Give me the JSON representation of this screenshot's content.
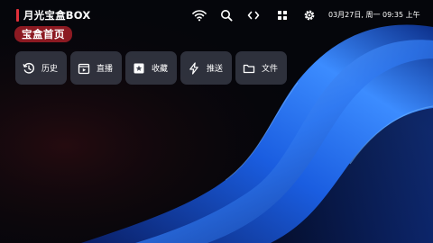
{
  "app": {
    "title": "月光宝盒BOX",
    "accent_color": "#e0303a"
  },
  "status_bar": {
    "icons": [
      "wifi-icon",
      "search-icon",
      "code-icon",
      "grid-icon",
      "settings-icon"
    ],
    "datetime": "03月27日, 周一 09:35 上午"
  },
  "home_chip": {
    "label": "宝盒首页",
    "color": "#8c1a22"
  },
  "quick_menu": {
    "items": [
      {
        "label": "历史",
        "icon": "history-icon"
      },
      {
        "label": "直播",
        "icon": "live-icon"
      },
      {
        "label": "收藏",
        "icon": "bookmark-icon"
      },
      {
        "label": "推送",
        "icon": "bolt-icon"
      },
      {
        "label": "文件",
        "icon": "folder-icon"
      }
    ]
  }
}
